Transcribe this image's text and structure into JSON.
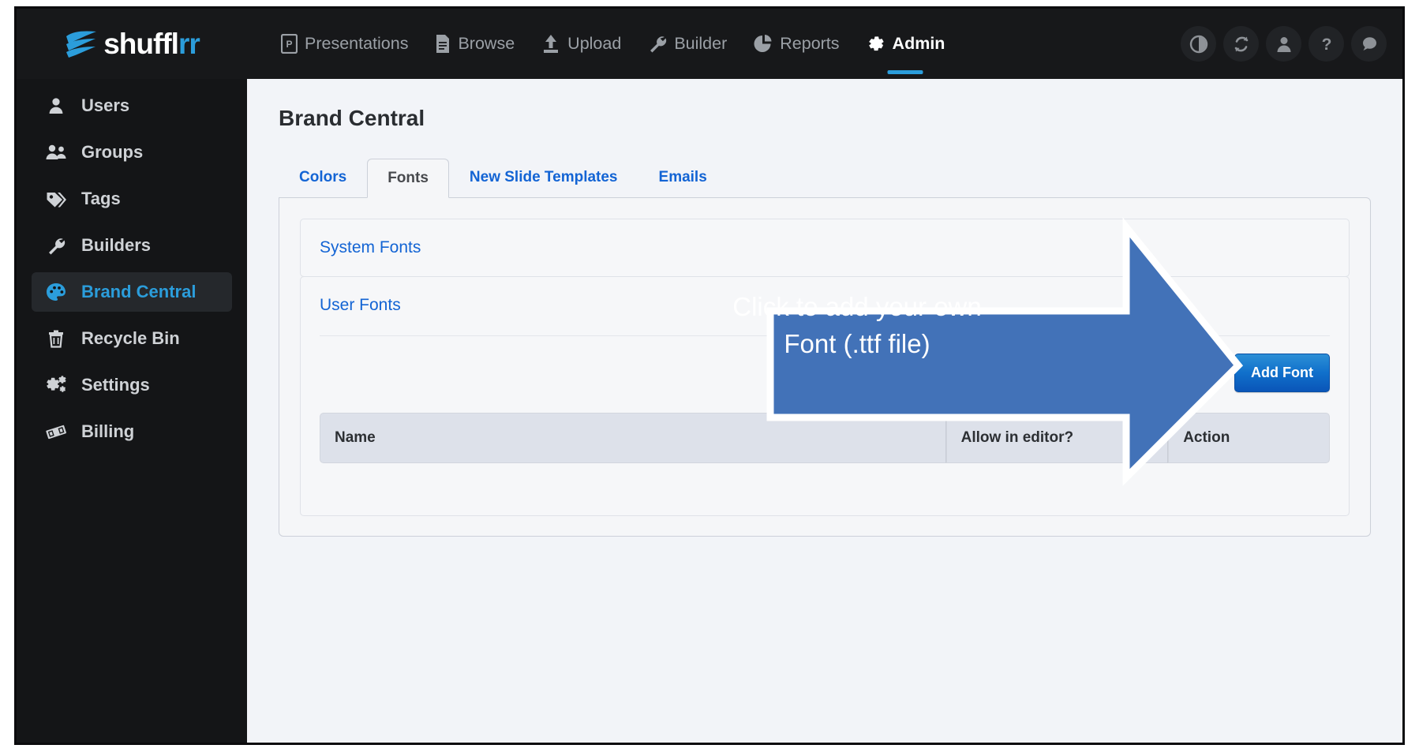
{
  "brand": {
    "logo_text_main": "shuffl",
    "logo_text_accent": "rr",
    "accent_color": "#2b9ddb",
    "link_color": "#1364d4"
  },
  "topnav": {
    "items": [
      {
        "label": "Presentations",
        "icon": "presentation-file-icon",
        "active": false
      },
      {
        "label": "Browse",
        "icon": "document-icon",
        "active": false
      },
      {
        "label": "Upload",
        "icon": "upload-icon",
        "active": false
      },
      {
        "label": "Builder",
        "icon": "wrench-icon",
        "active": false
      },
      {
        "label": "Reports",
        "icon": "pie-chart-icon",
        "active": false
      },
      {
        "label": "Admin",
        "icon": "gear-icon",
        "active": true
      }
    ],
    "actions": [
      {
        "name": "contrast-toggle-icon"
      },
      {
        "name": "refresh-sync-icon"
      },
      {
        "name": "user-profile-icon"
      },
      {
        "name": "help-question-icon"
      },
      {
        "name": "chat-bubble-icon"
      }
    ]
  },
  "sidebar": {
    "items": [
      {
        "label": "Users",
        "icon": "user-icon",
        "active": false
      },
      {
        "label": "Groups",
        "icon": "users-group-icon",
        "active": false
      },
      {
        "label": "Tags",
        "icon": "tag-icon",
        "active": false
      },
      {
        "label": "Builders",
        "icon": "wrench-icon",
        "active": false
      },
      {
        "label": "Brand Central",
        "icon": "palette-icon",
        "active": true
      },
      {
        "label": "Recycle Bin",
        "icon": "trash-icon",
        "active": false
      },
      {
        "label": "Settings",
        "icon": "gears-icon",
        "active": false
      },
      {
        "label": "Billing",
        "icon": "money-bill-icon",
        "active": false
      }
    ]
  },
  "page": {
    "title": "Brand Central",
    "tabs": [
      {
        "label": "Colors",
        "active": false
      },
      {
        "label": "Fonts",
        "active": true
      },
      {
        "label": "New Slide Templates",
        "active": false
      },
      {
        "label": "Emails",
        "active": false
      }
    ]
  },
  "fonts_panel": {
    "system_fonts_header": "System Fonts",
    "user_fonts_header": "User Fonts",
    "add_font_label": "Add Font",
    "table": {
      "columns": [
        "Name",
        "Allow in editor?",
        "Action"
      ],
      "rows": []
    }
  },
  "callout": {
    "line1": "Click to add your own",
    "line2": "Font (.ttf file)",
    "fill_color": "#4272b8",
    "border_color": "#ffffff"
  }
}
